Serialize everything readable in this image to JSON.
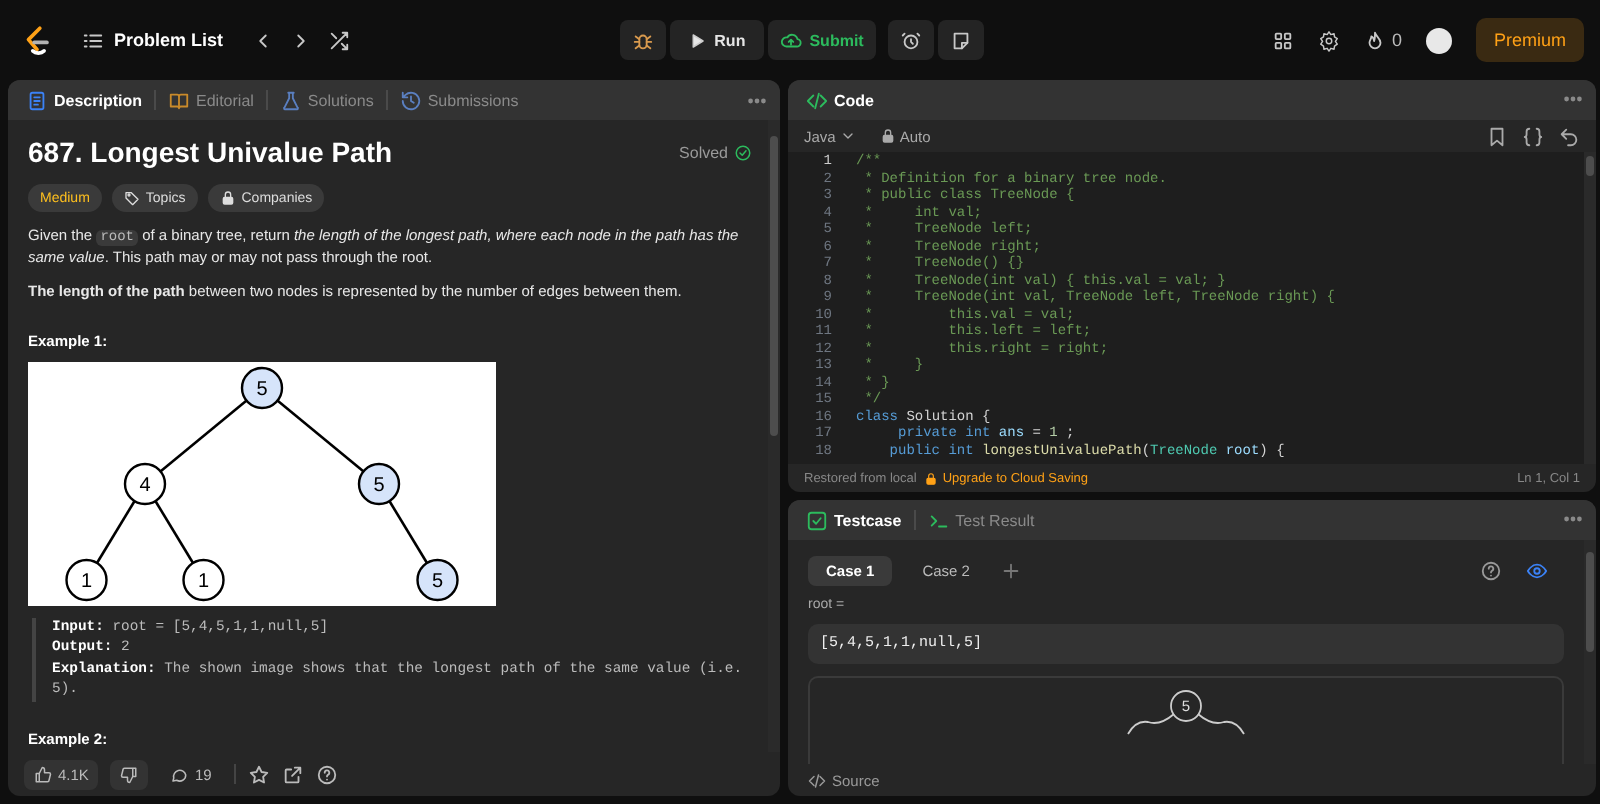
{
  "top_bar": {
    "problem_list": "Problem List",
    "run": "Run",
    "submit": "Submit",
    "streak": "0",
    "premium": "Premium"
  },
  "description_panel": {
    "tabs": [
      {
        "label": "Description",
        "selected": true
      },
      {
        "label": "Editorial",
        "selected": false
      },
      {
        "label": "Solutions",
        "selected": false
      },
      {
        "label": "Submissions",
        "selected": false
      }
    ],
    "title": "687. Longest Univalue Path",
    "status": "Solved",
    "tags": [
      {
        "kind": "difficulty",
        "label": "Medium"
      },
      {
        "kind": "topics",
        "label": "Topics"
      },
      {
        "kind": "companies",
        "label": "Companies"
      }
    ],
    "statement": [
      {
        "kind": "text",
        "text": "Given the "
      },
      {
        "kind": "code",
        "text": "root"
      },
      {
        "kind": "text",
        "text": " of a binary tree, return *the length of the longest path, where each node in the path has the same value*. This path may or may not pass through the root."
      }
    ],
    "note": "**The length of the path** between two nodes is represented by the number of edges between them.",
    "examples": [
      {
        "heading": "Example 1:",
        "tree": {
          "value": "5",
          "highlighted": true,
          "children": [
            {
              "value": "4",
              "highlighted": false,
              "children": [
                {
                  "value": "1",
                  "highlighted": false
                },
                {
                  "value": "1",
                  "highlighted": false
                }
              ]
            },
            {
              "value": "5",
              "highlighted": true,
              "children": [
                {
                  "value": "5",
                  "highlighted": true,
                  "kind": "right"
                }
              ]
            }
          ]
        },
        "lines": [
          "**Input:** root = [5,4,5,1,1,null,5]",
          "**Output:** 2",
          "**Explanation:** The shown image shows that the longest path of the same value (i.e. 5)."
        ]
      },
      {
        "heading": "Example 2:"
      }
    ],
    "likes": "4.1K",
    "comments": "19"
  },
  "code_panel": {
    "title": "Code",
    "language": "Java",
    "mode": "Auto",
    "lines": [
      {
        "number": "1",
        "tokens": [
          {
            "kind": "comment",
            "text": "/**"
          }
        ]
      },
      {
        "number": "2",
        "tokens": [
          {
            "kind": "comment",
            "text": " * Definition for a binary tree node."
          }
        ]
      },
      {
        "number": "3",
        "tokens": [
          {
            "kind": "comment",
            "text": " * public class TreeNode {"
          }
        ]
      },
      {
        "number": "4",
        "tokens": [
          {
            "kind": "comment",
            "text": " *     int val;"
          }
        ]
      },
      {
        "number": "5",
        "tokens": [
          {
            "kind": "comment",
            "text": " *     TreeNode left;"
          }
        ]
      },
      {
        "number": "6",
        "tokens": [
          {
            "kind": "comment",
            "text": " *     TreeNode right;"
          }
        ]
      },
      {
        "number": "7",
        "tokens": [
          {
            "kind": "comment",
            "text": " *     TreeNode() {}"
          }
        ]
      },
      {
        "number": "8",
        "tokens": [
          {
            "kind": "comment",
            "text": " *     TreeNode(int val) { this.val = val; }"
          }
        ]
      },
      {
        "number": "9",
        "tokens": [
          {
            "kind": "comment",
            "text": " *     TreeNode(int val, TreeNode left, TreeNode right) {"
          }
        ]
      },
      {
        "number": "10",
        "tokens": [
          {
            "kind": "comment",
            "text": " *         this.val = val;"
          }
        ]
      },
      {
        "number": "11",
        "tokens": [
          {
            "kind": "comment",
            "text": " *         this.left = left;"
          }
        ]
      },
      {
        "number": "12",
        "tokens": [
          {
            "kind": "comment",
            "text": " *         this.right = right;"
          }
        ]
      },
      {
        "number": "13",
        "tokens": [
          {
            "kind": "comment",
            "text": " *     }"
          }
        ]
      },
      {
        "number": "14",
        "tokens": [
          {
            "kind": "comment",
            "text": " * }"
          }
        ]
      },
      {
        "number": "15",
        "tokens": [
          {
            "kind": "comment",
            "text": " */"
          }
        ]
      },
      {
        "number": "16",
        "tokens": [
          {
            "kind": "keyword",
            "text": "class"
          },
          {
            "kind": "plain",
            "text": " Solution {"
          }
        ]
      },
      {
        "number": "17",
        "tokens": [
          {
            "kind": "keyword",
            "text": "     private"
          },
          {
            "kind": "keyword",
            "text": " int"
          },
          {
            "kind": "variable",
            "text": " ans"
          },
          {
            "kind": "plain",
            "text": " = "
          },
          {
            "kind": "number",
            "text": "1"
          },
          {
            "kind": "plain",
            "text": " ;"
          }
        ]
      },
      {
        "number": "18",
        "tokens": [
          {
            "kind": "keyword",
            "text": "    public"
          },
          {
            "kind": "keyword",
            "text": " int"
          },
          {
            "kind": "function",
            "text": " longestUnivaluePath"
          },
          {
            "kind": "plain",
            "text": "("
          },
          {
            "kind": "type",
            "text": "TreeNode"
          },
          {
            "kind": "variable",
            "text": " root"
          },
          {
            "kind": "plain",
            "text": ") {"
          }
        ]
      }
    ],
    "status": "Restored from local",
    "upgrade": "Upgrade to Cloud Saving",
    "cursor": "Ln 1, Col 1"
  },
  "test_panel": {
    "tabs": [
      {
        "label": "Testcase",
        "selected": true
      },
      {
        "label": "Test Result",
        "selected": false
      }
    ],
    "cases": [
      {
        "label": "Case 1",
        "selected": true
      },
      {
        "label": "Case 2",
        "selected": false
      }
    ],
    "input_label": "root =",
    "input_value": "[5,4,5,1,1,null,5]",
    "preview_root": "5",
    "source": "Source"
  }
}
